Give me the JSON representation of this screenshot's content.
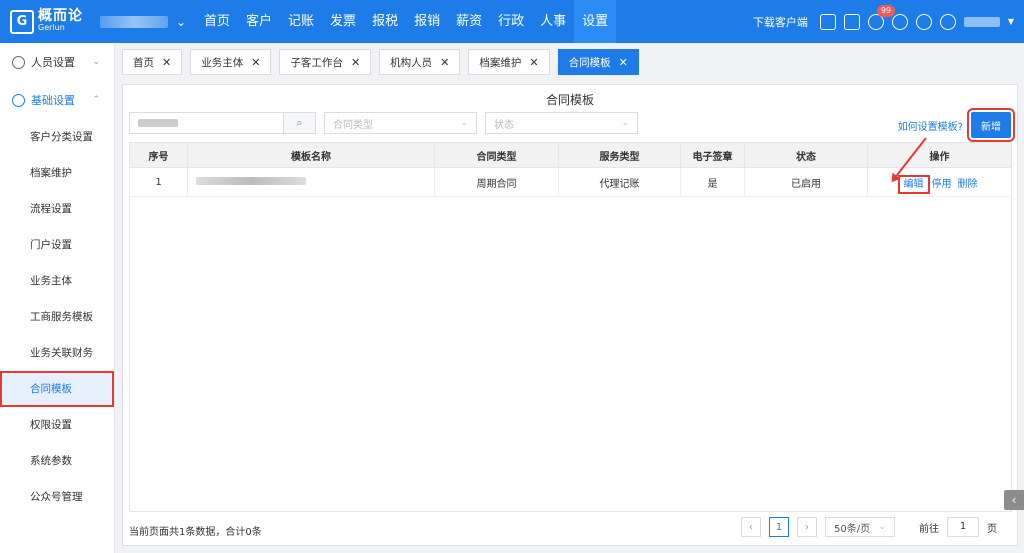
{
  "header": {
    "logo_cn": "概而论",
    "logo_en": "Gerlun",
    "nav": [
      "首页",
      "客户",
      "记账",
      "发票",
      "报税",
      "报销",
      "薪资",
      "行政",
      "人事",
      "设置"
    ],
    "download_label": "下载客户端",
    "badge_count": "99"
  },
  "sidebar": {
    "group1": "人员设置",
    "group2": "基础设置",
    "items": [
      "客户分类设置",
      "档案维护",
      "流程设置",
      "门户设置",
      "业务主体",
      "工商服务模板",
      "业务关联财务",
      "合同模板",
      "权限设置",
      "系统参数",
      "公众号管理"
    ]
  },
  "tabs": [
    "首页",
    "业务主体",
    "子客工作台",
    "机构人员",
    "档案维护",
    "合同模板"
  ],
  "panel": {
    "title": "合同模板",
    "contract_type_placeholder": "合同类型",
    "status_placeholder": "状态",
    "help_link": "如何设置模板?",
    "add_label": "新增"
  },
  "table": {
    "headers": [
      "序号",
      "模板名称",
      "合同类型",
      "服务类型",
      "电子签章",
      "状态",
      "操作"
    ],
    "rows": [
      {
        "index": "1",
        "contract_type": "周期合同",
        "service_type": "代理记账",
        "e_sign": "是",
        "status": "已启用",
        "op_edit": "编辑",
        "op_disable": "停用",
        "op_delete": "删除"
      }
    ]
  },
  "footer": {
    "summary": "当前页面共1条数据，合计0条",
    "current_page": "1",
    "page_size": "50条/页",
    "goto_label": "前往",
    "goto_value": "1",
    "page_unit": "页"
  }
}
